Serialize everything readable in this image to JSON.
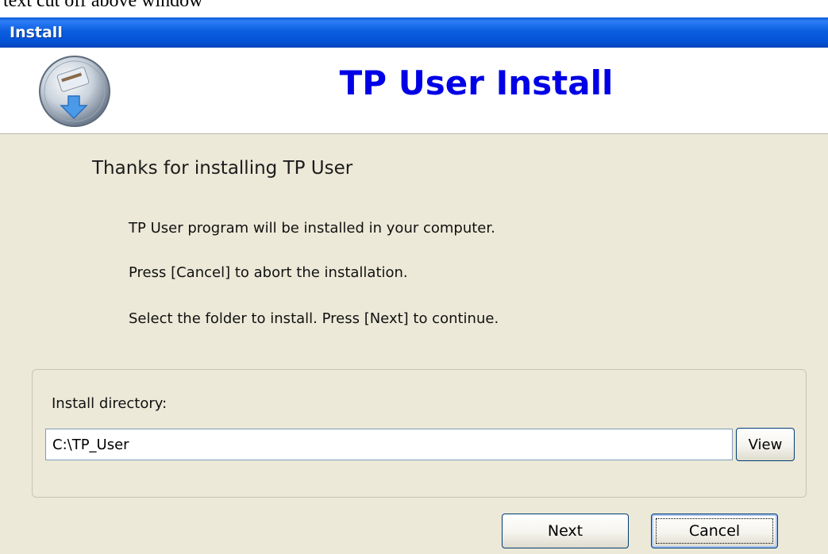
{
  "window": {
    "title": "Install"
  },
  "header": {
    "title": "TP User Install",
    "logo_icon": "install-disc-arrow-icon"
  },
  "body": {
    "welcome": "Thanks for installing TP User",
    "lines": [
      "TP User program will be installed in your computer.",
      "Press [Cancel] to abort the installation.",
      "Select the folder to install.  Press [Next] to continue."
    ]
  },
  "directory": {
    "label": "Install directory:",
    "value": "C:\\TP_User",
    "view_label": "View"
  },
  "buttons": {
    "next_label": "Next",
    "cancel_label": "Cancel"
  },
  "colors": {
    "title_bar": "#0553d6",
    "header_title": "#0000e6",
    "window_bg": "#ece9d8"
  }
}
